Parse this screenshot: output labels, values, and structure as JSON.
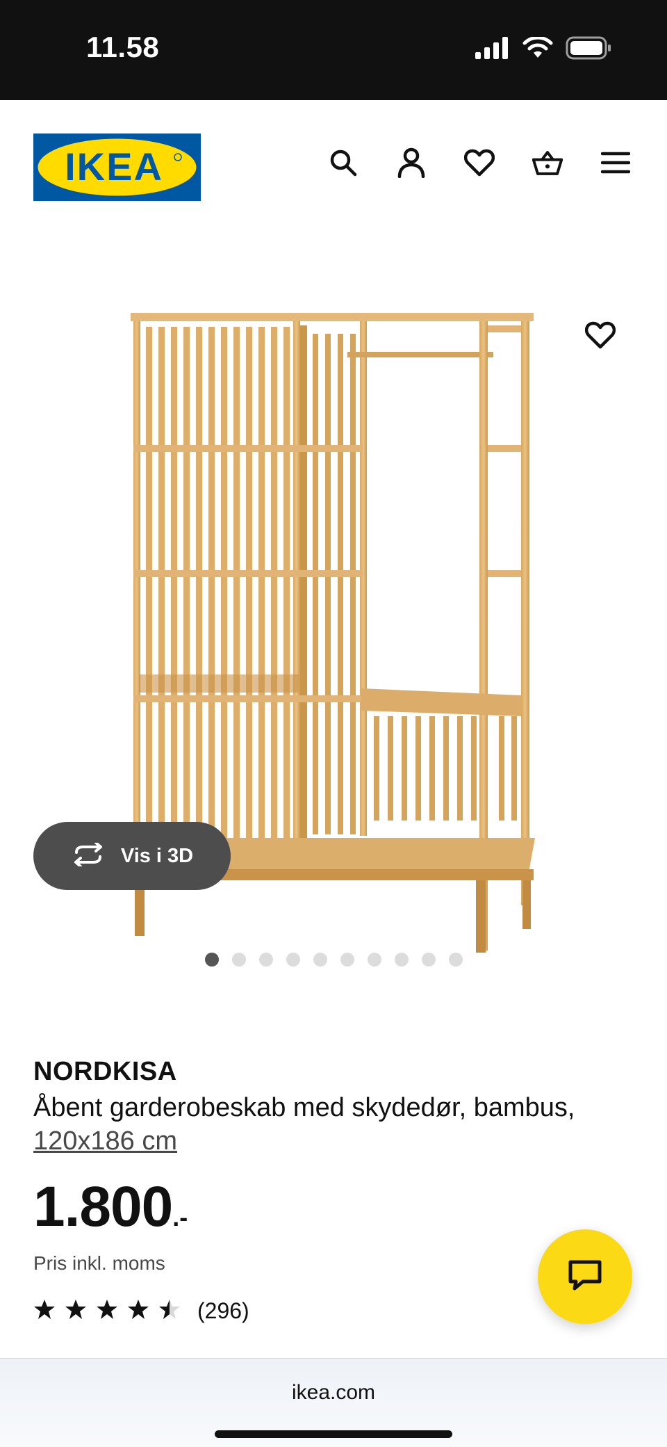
{
  "status_bar": {
    "time": "11.58",
    "icons": [
      "signal-icon",
      "wifi-icon",
      "battery-icon"
    ]
  },
  "header": {
    "logo_text": "IKEA",
    "brand_colors": {
      "blue": "#0058A3",
      "yellow": "#FFDB00"
    },
    "icons": [
      "search-icon",
      "account-icon",
      "favorites-icon",
      "basket-icon",
      "menu-icon"
    ]
  },
  "gallery": {
    "view_3d_label": "Vis i 3D",
    "view_3d_icon": "rotate-3d-icon",
    "favorite_icon": "heart-icon",
    "image_count": 10,
    "active_index": 0
  },
  "product": {
    "name": "NORDKISA",
    "description": "Åbent garderobeskab med skydedør, bambus,",
    "size": "120x186 cm",
    "price": "1.800",
    "price_suffix": ".-",
    "price_note": "Pris inkl. moms",
    "rating": 4.5,
    "rating_max": 5,
    "rating_count": "(296)"
  },
  "chat": {
    "icon": "chat-icon",
    "color": "#FBD914"
  },
  "browser": {
    "url": "ikea.com"
  }
}
